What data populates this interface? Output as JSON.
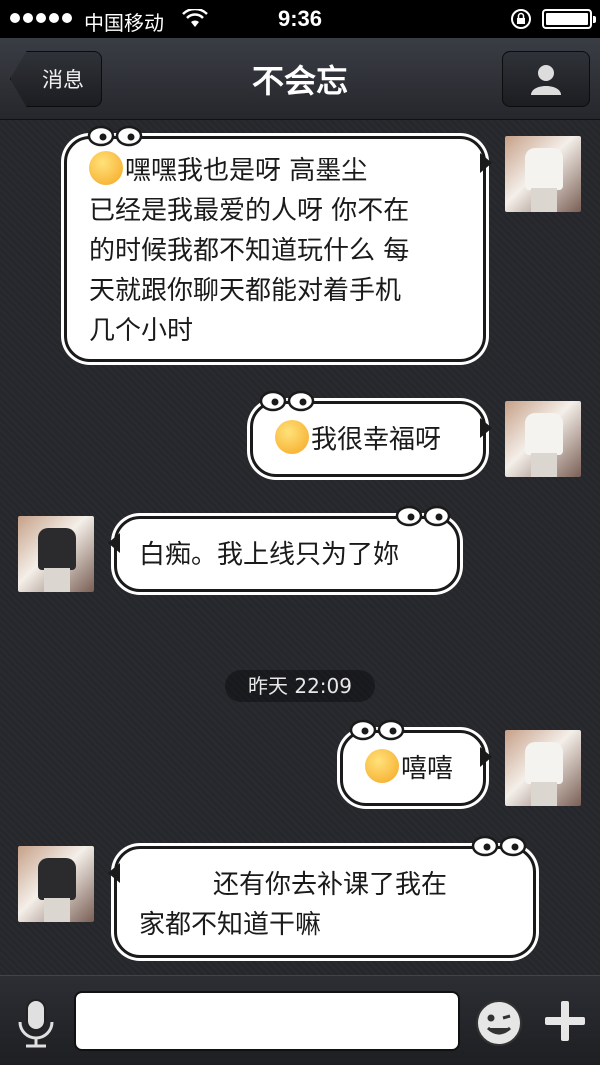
{
  "status_bar": {
    "carrier": "中国移动",
    "time": "9:36"
  },
  "nav": {
    "back_label": "消息",
    "title": "不会忘"
  },
  "messages": [
    {
      "side": "right",
      "text": "嘿嘿我也是呀 高墨尘\n已经是我最爱的人呀 你不在\n的时候我都不知道玩什么 每\n天就跟你聊天都能对着手机\n几个小时",
      "emoji": "smiley"
    },
    {
      "side": "right",
      "text": "我很幸福呀",
      "emoji": "smiley"
    },
    {
      "side": "left",
      "text": "白痴。我上线只为了妳"
    },
    {
      "side": "right",
      "text": "嘻嘻",
      "emoji": "smiley"
    },
    {
      "side": "left",
      "text": "还有你去补课了我在\n家都不知道干嘛"
    }
  ],
  "timestamp": "昨天 22:09",
  "input": {
    "value": "",
    "placeholder": ""
  },
  "colors": {
    "status_bar": "#000000",
    "nav_bar": "#2f3238",
    "chat_background": "#2a2b30",
    "bubble": "#ffffff",
    "bubble_border": "#1a1a1a"
  },
  "icons": [
    "wifi-icon",
    "lock-rotation-icon",
    "battery-icon",
    "profile-icon",
    "microphone-icon",
    "emoji-icon",
    "plus-icon",
    "smiley-emoji-icon"
  ]
}
